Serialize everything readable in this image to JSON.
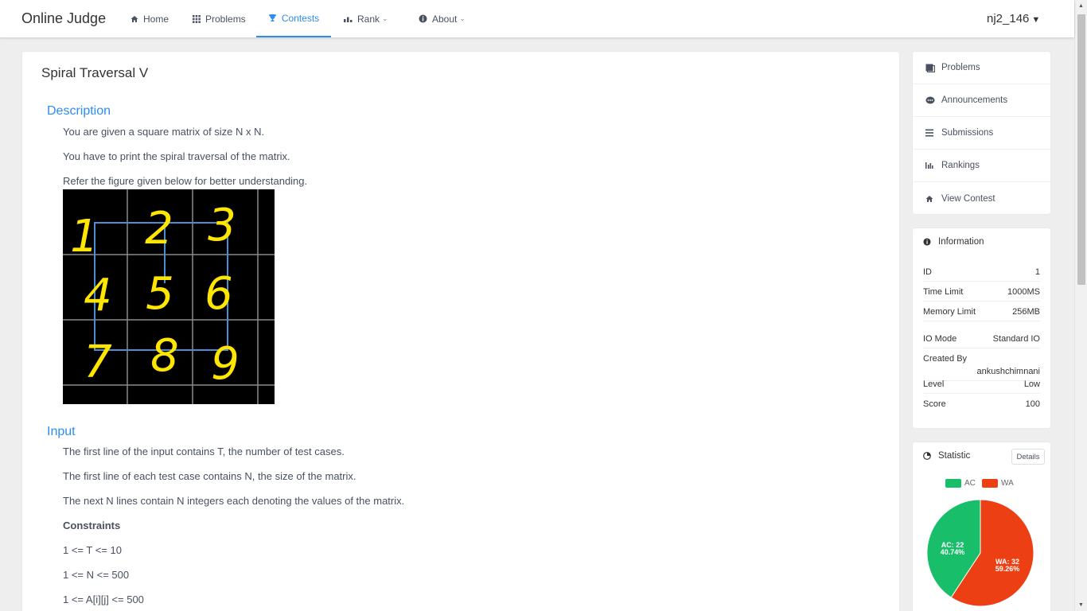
{
  "nav": {
    "logo": "Online Judge",
    "items": [
      {
        "label": "Home",
        "icon": "home-icon"
      },
      {
        "label": "Problems",
        "icon": "grid-icon"
      },
      {
        "label": "Contests",
        "icon": "trophy-icon",
        "active": true
      },
      {
        "label": "Rank",
        "icon": "bar-chart-icon",
        "dropdown": true
      },
      {
        "label": "About",
        "icon": "info-icon",
        "dropdown": true
      }
    ],
    "user": "nj2_146"
  },
  "problem": {
    "title": "Spiral Traversal V",
    "description_title": "Description",
    "description": [
      "You are given a square matrix of size N x N.",
      "You have to print the spiral traversal of the matrix.",
      "Refer the figure given below for better understanding."
    ],
    "figure_digits": [
      "1",
      "2",
      "3",
      "4",
      "5",
      "6",
      "7",
      "8",
      "9"
    ],
    "input_title": "Input",
    "input": [
      "The first line of the input contains T, the number of test cases.",
      "The first line of each test case contains N, the size of the matrix.",
      "The next N lines contain N integers each denoting the values of the matrix."
    ],
    "constraints_title": "Constraints",
    "constraints": [
      "1 <= T <= 10",
      "1 <= N <= 500",
      "1 <= A[i][j] <= 500"
    ]
  },
  "sidebar": {
    "menu": [
      {
        "label": "Problems",
        "icon": "problems-icon"
      },
      {
        "label": "Announcements",
        "icon": "announcement-icon"
      },
      {
        "label": "Submissions",
        "icon": "list-icon"
      },
      {
        "label": "Rankings",
        "icon": "bar-chart-icon"
      },
      {
        "label": "View Contest",
        "icon": "home-icon"
      }
    ],
    "info": {
      "title": "Information",
      "rows": [
        {
          "key": "ID",
          "value": "1"
        },
        {
          "key": "Time Limit",
          "value": "1000MS"
        },
        {
          "key": "Memory Limit",
          "value": "256MB"
        },
        {
          "key": "IO Mode",
          "value": "Standard IO"
        },
        {
          "key": "Created By",
          "value": "ankushchimnani"
        },
        {
          "key": "Level",
          "value": "Low"
        },
        {
          "key": "Score",
          "value": "100"
        }
      ]
    },
    "statistic": {
      "title": "Statistic",
      "details_label": "Details",
      "legend": [
        {
          "label": "AC",
          "color": "#19be6b"
        },
        {
          "label": "WA",
          "color": "#ed3f14"
        }
      ],
      "ac_label": [
        "AC: 22",
        "40.74%"
      ],
      "wa_label": [
        "WA: 32",
        "59.26%"
      ]
    }
  },
  "chart_data": {
    "type": "pie",
    "categories": [
      "AC",
      "WA"
    ],
    "values": [
      22,
      32
    ],
    "percentages": [
      "40.74%",
      "59.26%"
    ],
    "colors": [
      "#19be6b",
      "#ed3f14"
    ],
    "legend": "top"
  }
}
